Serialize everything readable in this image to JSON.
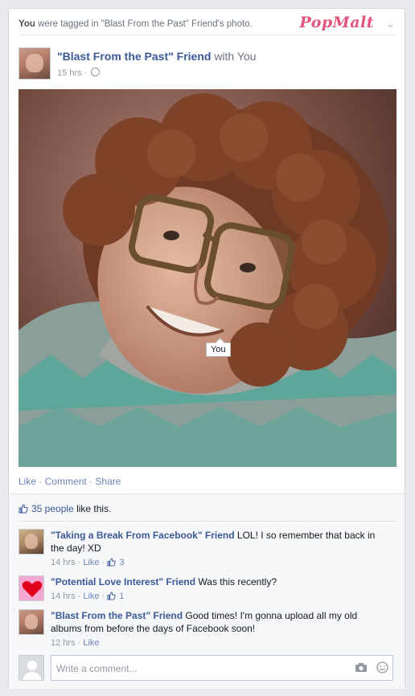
{
  "notification": {
    "actor": "You",
    "text": "were tagged in \"Blast From the Past\" Friend's photo."
  },
  "brand": {
    "name": "PopMalt",
    "color": "#e2547a"
  },
  "post": {
    "author": "\"Blast From the Past\" Friend",
    "with_text": "with You",
    "time": "15 hrs",
    "tag_label": "You"
  },
  "actions": {
    "like": "Like",
    "comment": "Comment",
    "share": "Share"
  },
  "likes": {
    "count_text": "35 people",
    "suffix": "like this."
  },
  "comments": [
    {
      "author": "\"Taking a Break From Facebook\" Friend",
      "text": "LOL! I so remember that back in the day! XD",
      "time": "14 hrs",
      "like": "Like",
      "like_count": "3"
    },
    {
      "author": "\"Potential Love Interest\" Friend",
      "text": "Was this recently?",
      "time": "14 hrs",
      "like": "Like",
      "like_count": "1"
    },
    {
      "author": "\"Blast From the Past\" Friend",
      "text": "Good times! I'm gonna upload all my old albums from before the days of Facebook soon!",
      "time": "12 hrs",
      "like": "Like"
    }
  ],
  "write_comment": {
    "placeholder": "Write a comment..."
  },
  "colors": {
    "link": "#3b5998",
    "muted": "#9197a3",
    "background": "#e9eaed"
  }
}
